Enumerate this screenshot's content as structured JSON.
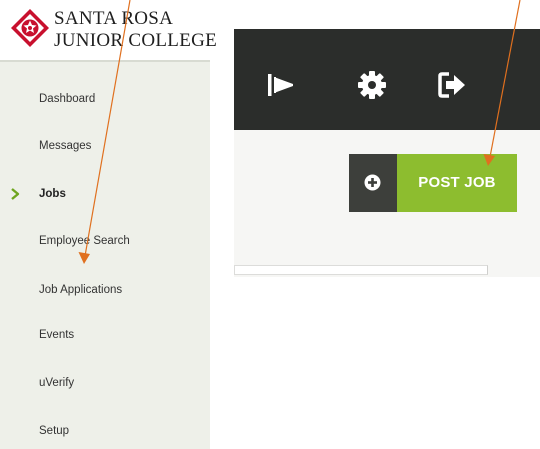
{
  "logo": {
    "line1": "SANTA ROSA",
    "line2": "JUNIOR COLLEGE",
    "colors": {
      "red": "#c8102e",
      "text": "#1f1f1f"
    }
  },
  "sidebar": {
    "items": [
      {
        "label": "Dashboard",
        "active": false
      },
      {
        "label": "Messages",
        "active": false
      },
      {
        "label": "Jobs",
        "active": true
      },
      {
        "label": "Employee Search",
        "active": false
      },
      {
        "label": "Job Applications",
        "active": false
      },
      {
        "label": "Events",
        "active": false
      },
      {
        "label": "uVerify",
        "active": false
      },
      {
        "label": "Setup",
        "active": false
      }
    ],
    "active_marker_icon": "chevron-right-icon",
    "accent_color": "#6fa51f"
  },
  "topbar": {
    "icons": [
      "megaphone-icon",
      "gear-icon",
      "sign-out-icon"
    ],
    "background": "#2b2d2b"
  },
  "post_job_button": {
    "label": "POST JOB",
    "icon": "plus-circle-icon",
    "color": "#8dbd2f",
    "icon_bg": "#3d3f3b"
  },
  "annotations": {
    "arrow_color": "#e0701f"
  }
}
